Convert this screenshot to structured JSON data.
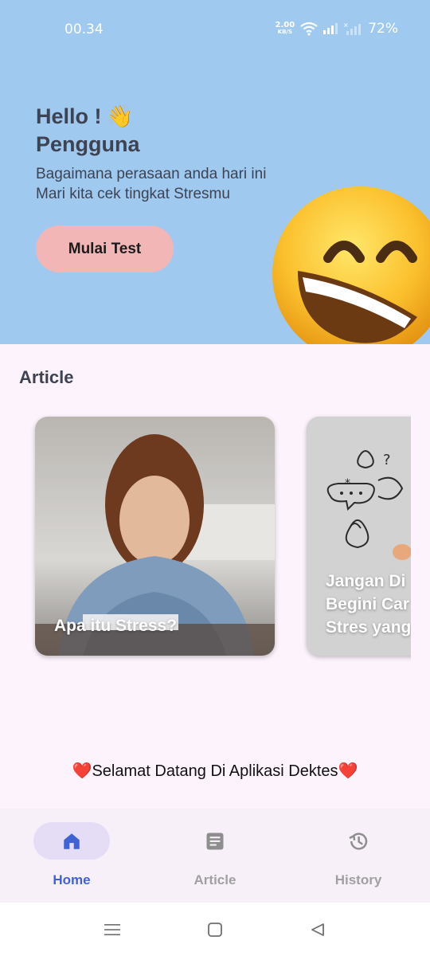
{
  "status_bar": {
    "time": "00.34",
    "net_speed_value": "2.00",
    "net_speed_unit": "KB/S",
    "battery": "72%"
  },
  "hero": {
    "hello": "Hello !",
    "wave_emoji": "👋",
    "name": "Pengguna",
    "subtitle_line1": "Bagaimana perasaan anda hari ini",
    "subtitle_line2": "Mari kita cek tingkat Stresmu",
    "start_button": "Mulai Test"
  },
  "article_section": {
    "title": "Article",
    "cards": [
      {
        "title": "Apa itu Stress?"
      },
      {
        "title": "Jangan Di... Begini Car... Stres yang...",
        "title_lines": [
          "Jangan Di",
          "Begini Car",
          "Stres yang"
        ]
      }
    ]
  },
  "welcome": {
    "heart": "❤️",
    "text": "Selamat Datang Di Aplikasi Dektes"
  },
  "bottom_nav": {
    "items": [
      {
        "label": "Home",
        "icon": "home-icon",
        "active": true
      },
      {
        "label": "Article",
        "icon": "article-icon",
        "active": false
      },
      {
        "label": "History",
        "icon": "history-icon",
        "active": false
      }
    ]
  },
  "colors": {
    "hero_bg": "#a0c9ef",
    "page_bg": "#fcf3fc",
    "start_button": "#f3b6b6",
    "nav_active": "#3f63d3",
    "nav_active_pill": "#e5dcf6",
    "nav_inactive": "#a0a0a0"
  }
}
